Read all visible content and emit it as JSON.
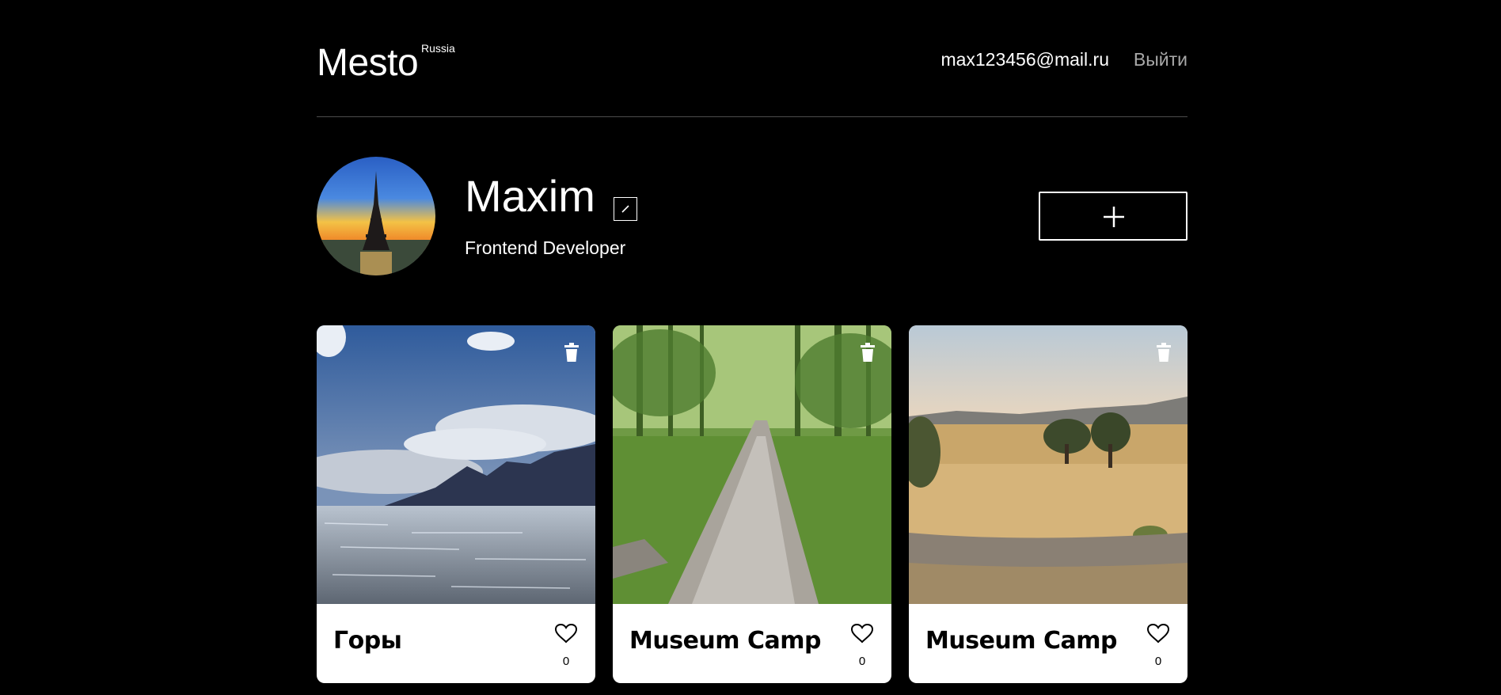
{
  "header": {
    "logo": "Mesto",
    "logo_sup": "Russia",
    "email": "max123456@mail.ru",
    "logout": "Выйти"
  },
  "profile": {
    "name": "Maxim",
    "about": "Frontend Developer",
    "avatar_icon": "eiffel-tower-photo"
  },
  "cards": [
    {
      "title": "Горы",
      "likes": "0",
      "image": "lake-mountains-photo"
    },
    {
      "title": "Museum Camp",
      "likes": "0",
      "image": "forest-trail-photo"
    },
    {
      "title": "Museum Camp",
      "likes": "0",
      "image": "meadow-trees-photo"
    }
  ],
  "colors": {
    "background": "#000000",
    "card": "#ffffff",
    "muted": "#a9a9a9"
  }
}
